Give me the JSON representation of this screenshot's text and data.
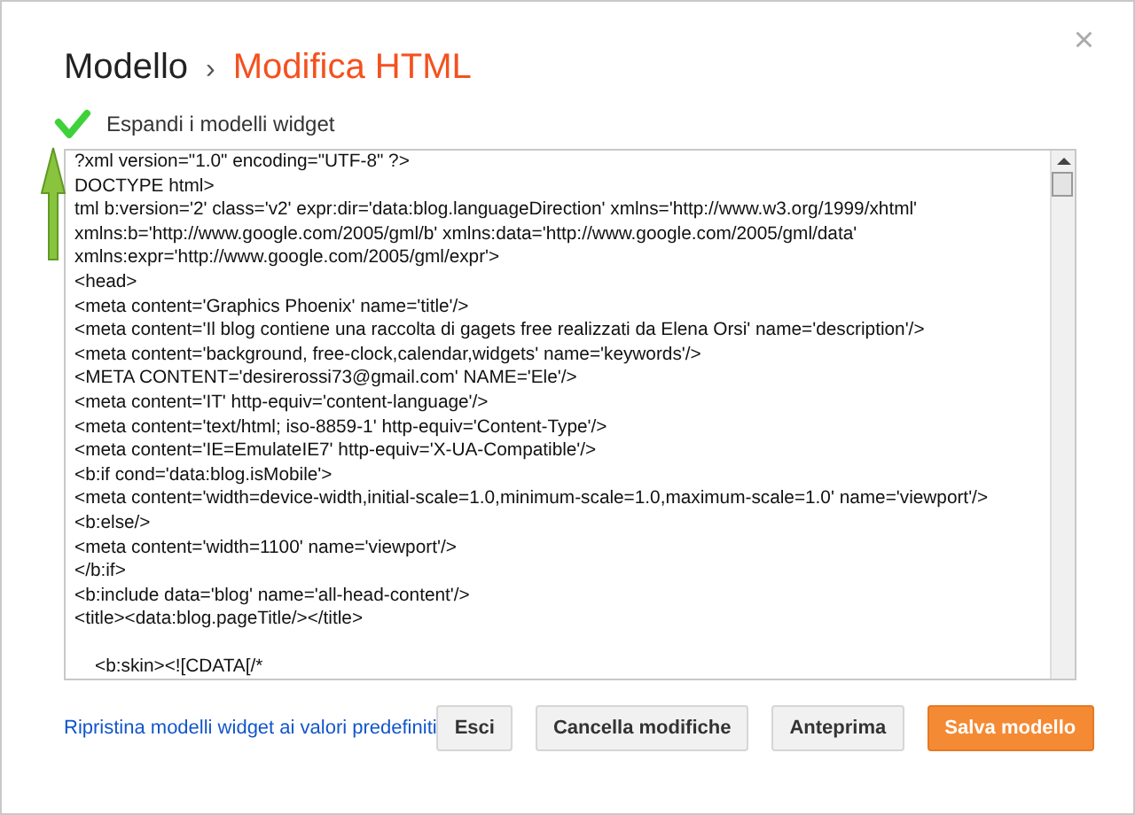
{
  "breadcrumb": {
    "parent": "Modello",
    "separator": "›",
    "current": "Modifica HTML"
  },
  "close": "×",
  "expand_widgets": {
    "label": "Espandi i modelli widget",
    "checked": true
  },
  "editor": {
    "lines": [
      {
        "kind": "code",
        "text": "?xml version=\"1.0\" encoding=\"UTF-8\" ?>"
      },
      {
        "kind": "code",
        "text": "DOCTYPE html>"
      },
      {
        "kind": "code",
        "text": "tml b:version='2' class='v2' expr:dir='data:blog.languageDirection' xmlns='http://www.w3.org/1999/xhtml'"
      },
      {
        "kind": "code",
        "text": "xmlns:b='http://www.google.com/2005/gml/b' xmlns:data='http://www.google.com/2005/gml/data'"
      },
      {
        "kind": "code",
        "text": "xmlns:expr='http://www.google.com/2005/gml/expr'>"
      },
      {
        "kind": "code",
        "text": "<head>"
      },
      {
        "kind": "code",
        "text": "<meta content='Graphics Phoenix' name='title'/>"
      },
      {
        "kind": "code",
        "text": "<meta content='Il blog contiene una raccolta di gagets free realizzati da Elena Orsi' name='description'/>"
      },
      {
        "kind": "code",
        "text": "<meta content='background, free-clock,calendar,widgets' name='keywords'/>"
      },
      {
        "kind": "code",
        "text": "<META CONTENT='desirerossi73@gmail.com' NAME='Ele'/>"
      },
      {
        "kind": "code",
        "text": "<meta content='IT' http-equiv='content-language'/>"
      },
      {
        "kind": "code",
        "text": "<meta content='text/html; iso-8859-1' http-equiv='Content-Type'/>"
      },
      {
        "kind": "code",
        "text": "<meta content='IE=EmulateIE7' http-equiv='X-UA-Compatible'/>"
      },
      {
        "kind": "code",
        "text": "<b:if cond='data:blog.isMobile'>"
      },
      {
        "kind": "code",
        "text": "<meta content='width=device-width,initial-scale=1.0,minimum-scale=1.0,maximum-scale=1.0' name='viewport'/>"
      },
      {
        "kind": "code",
        "text": "<b:else/>"
      },
      {
        "kind": "code",
        "text": "<meta content='width=1100' name='viewport'/>"
      },
      {
        "kind": "code",
        "text": "</b:if>"
      },
      {
        "kind": "code",
        "text": "<b:include data='blog' name='all-head-content'/>"
      },
      {
        "kind": "code",
        "text": "<title><data:blog.pageTitle/></title>"
      },
      {
        "kind": "blank"
      },
      {
        "kind": "code",
        "text": "    <b:skin><![CDATA[/*"
      }
    ]
  },
  "reset_link": "Ripristina modelli widget ai valori predefiniti",
  "buttons": [
    {
      "label": "Esci",
      "kind": "plain"
    },
    {
      "label": "Cancella modifiche",
      "kind": "plain"
    },
    {
      "label": "Anteprima",
      "kind": "plain"
    },
    {
      "label": "Salva modello",
      "kind": "primary"
    }
  ]
}
